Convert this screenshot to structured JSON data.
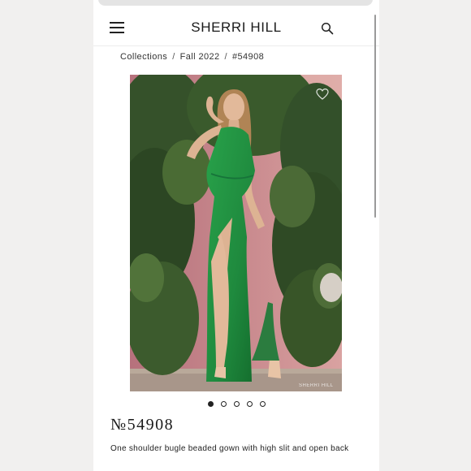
{
  "header": {
    "logo": "SHERRI HILL",
    "menu_icon": "hamburger-menu-icon",
    "search_icon": "search-icon"
  },
  "breadcrumb": {
    "items": [
      "Collections",
      "Fall 2022",
      "#54908"
    ],
    "separator": "/"
  },
  "product": {
    "photo_alt": "Model in green one shoulder beaded gown in front of leafy plants",
    "favorite_icon": "heart-icon",
    "carousel": {
      "count": 5,
      "active_index": 0
    },
    "style_number": "№54908",
    "description": "One shoulder bugle beaded gown with high slit and open back",
    "watermark": "SHERRI HILL"
  },
  "colors": {
    "dress_green": "#1f8a3e",
    "background": "#f1f0ef",
    "text": "#1a1a1a"
  }
}
